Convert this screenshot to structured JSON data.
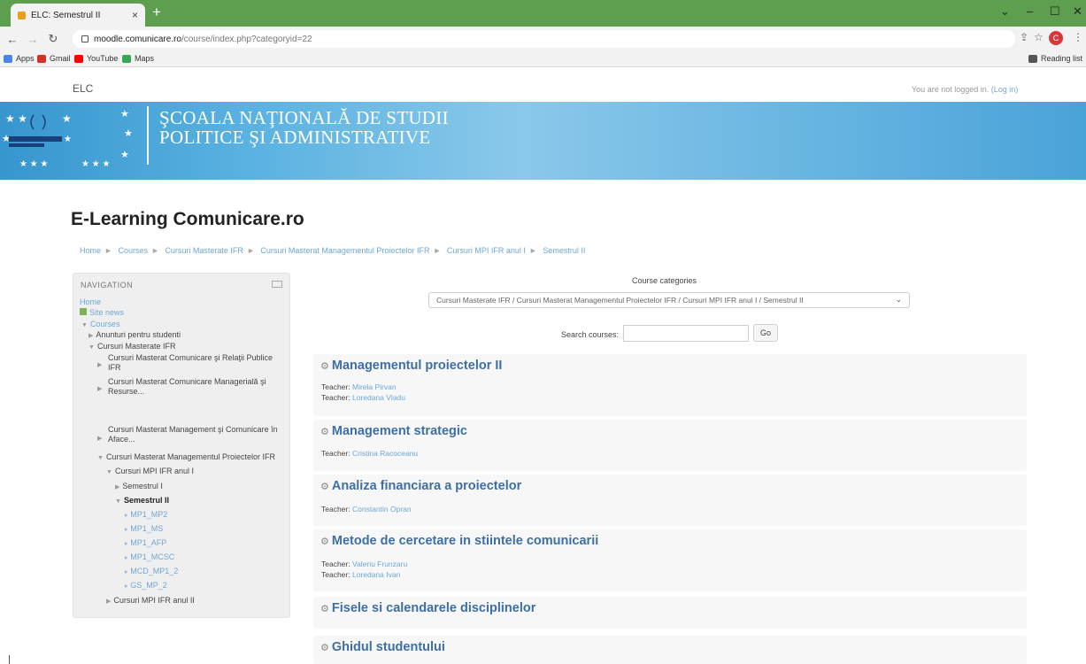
{
  "browser": {
    "tab_title": "ELC: Semestrul II",
    "tab_close": "×",
    "new_tab": "+",
    "url_host": "moodle.comunicare.ro",
    "url_path": "/course/index.php?categoryid=22",
    "profile_initial": "C",
    "bookmarks": [
      "Apps",
      "Gmail",
      "YouTube",
      "Maps"
    ],
    "reading_list": "Reading list"
  },
  "site": {
    "shortname": "ELC",
    "login_text": "You are not logged in.",
    "login_link": "(Log in)",
    "banner_line1": "ŞCOALA NAŢIONALĂ DE STUDII",
    "banner_line2": "POLITICE ŞI ADMINISTRATIVE",
    "title": "E-Learning Comunicare.ro"
  },
  "breadcrumb": [
    "Home",
    "Courses",
    "Cursuri Masterate IFR",
    "Cursuri Masterat Managementul Proiectelor IFR",
    "Cursuri MPI IFR anul I",
    "Semestrul II"
  ],
  "navigation": {
    "heading": "NAVIGATION",
    "home": "Home",
    "site_news": "Site news",
    "courses": "Courses",
    "anunturi": "Anunturi pentru studenti",
    "masterate": "Cursuri Masterate IFR",
    "crp_1": "Cursuri Masterat Comunicare şi Relaţii Publice",
    "crp_2": "IFR",
    "cmr_1": "Cursuri Masterat Comunicare Managerială şi",
    "cmr_2": "Resurse...",
    "mca_1": "Cursuri Masterat Management şi Comunicare în",
    "mca_2": "Aface...",
    "mpi": "Cursuri Masterat Managementul Proiectelor IFR",
    "mpi_anul1": "Cursuri MPI IFR anul I",
    "sem1": "Semestrul I",
    "sem2": "Semestrul II",
    "sub": [
      "MP1_MP2",
      "MP1_MS",
      "MP1_AFP",
      "MP1_MCSC",
      "MCD_MP1_2",
      "GS_MP_2"
    ],
    "mpi_anul2": "Cursuri MPI IFR anul II"
  },
  "main": {
    "category_label": "Course categories",
    "category_value": "Cursuri Masterate IFR / Cursuri Masterat Managementul Proiectelor IFR / Cursuri MPI IFR anul I / Semestrul II",
    "search_label": "Search courses:",
    "search_value": "",
    "go": "Go"
  },
  "courses": [
    {
      "title": "Managementul proiectelor II",
      "teacher_label": "Teacher:",
      "teachers": [
        "Mirela Pirvan",
        "Loredana Vladu"
      ]
    },
    {
      "title": "Management strategic",
      "teacher_label": "Teacher:",
      "teachers": [
        "Cristina Racoceanu"
      ]
    },
    {
      "title": "Analiza financiara a proiectelor",
      "teacher_label": "Teacher:",
      "teachers": [
        "Constantin Opran"
      ]
    },
    {
      "title": "Metode de cercetare in stiintele comunicarii",
      "teacher_label": "Teacher:",
      "teachers": [
        "Valeriu Frunzaru",
        "Loredana Ivan"
      ]
    },
    {
      "title": "Fisele si calendarele disciplinelor",
      "teacher_label": "",
      "teachers": []
    },
    {
      "title": "Ghidul studentului",
      "teacher_label": "",
      "teachers": []
    }
  ],
  "colors": {
    "tabstrip": "#5d9e4f",
    "link": "#6ea7d6",
    "course_title": "#3d6fa6",
    "banner": "#58b1e0"
  }
}
